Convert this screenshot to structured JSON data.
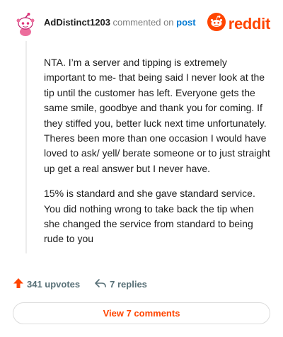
{
  "comment": {
    "username": "AdDistinct1203",
    "commented_on": "commented on",
    "post_link": "post",
    "paragraphs": [
      "NTA. I’m a server and tipping is extremely important to me- that being said I never look at the tip until the customer has left. Everyone gets the same smile, goodbye and thank you for coming. If they stiffed you, better luck next time unfortunately. Theres been more than one occasion I would have loved to ask/ yell/ berate someone or to just straight up get a real answer but I never have.",
      "15% is standard and she gave standard service. You did nothing wrong to take back the tip when she changed the service from standard to being rude to you"
    ]
  },
  "brand": {
    "wordmark": "reddit",
    "color": "#ff4500"
  },
  "actions": {
    "upvotes": "341 upvotes",
    "replies": "7 replies"
  },
  "footer": {
    "view_comments": "View 7 comments"
  },
  "icons": {
    "avatar": "snoo-avatar-icon",
    "logo": "reddit-logo-icon",
    "upvote": "upvote-arrow-icon",
    "reply": "reply-arrow-icon"
  }
}
